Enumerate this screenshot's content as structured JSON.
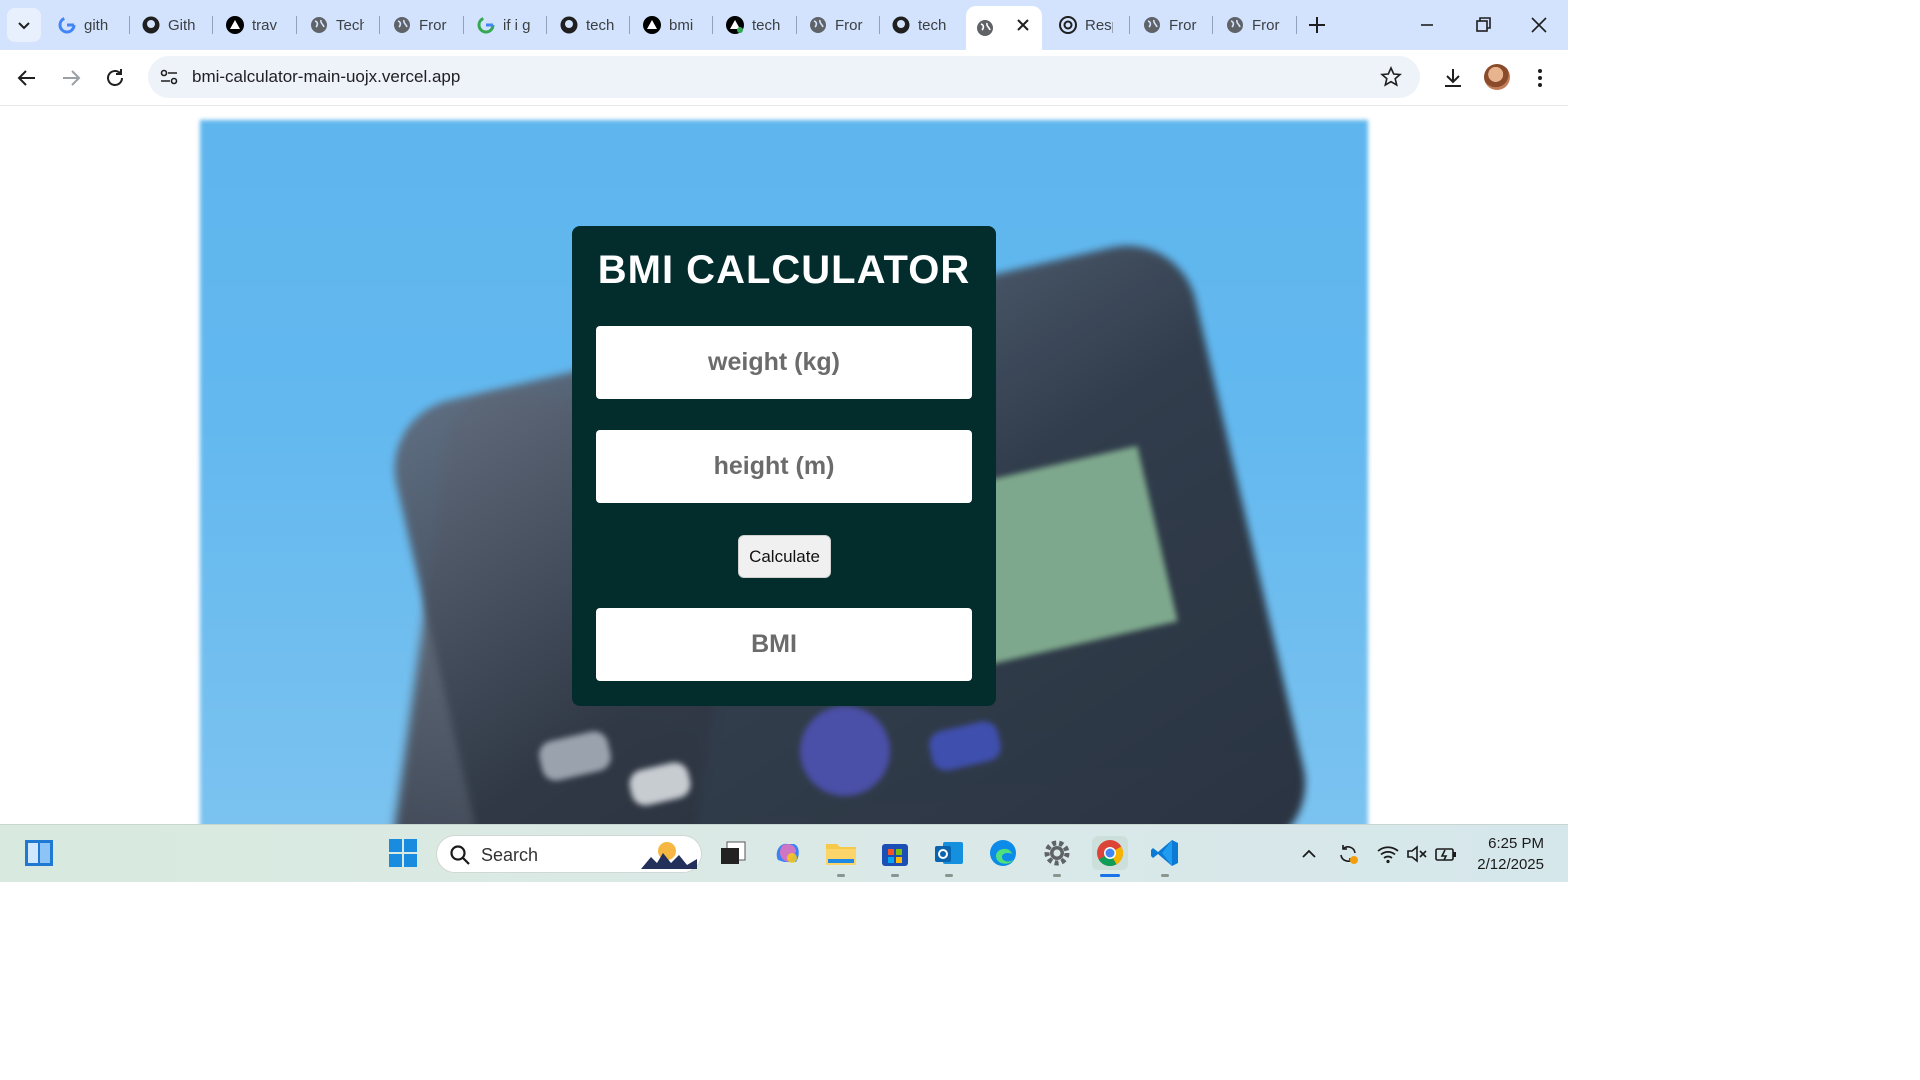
{
  "browser": {
    "tabs": [
      {
        "label": "gith",
        "icon": "google-icon"
      },
      {
        "label": "Gith",
        "icon": "github-icon"
      },
      {
        "label": "trav",
        "icon": "vercel-icon"
      },
      {
        "label": "Tech",
        "icon": "globe-icon"
      },
      {
        "label": "Fror",
        "icon": "globe-icon"
      },
      {
        "label": "if i g",
        "icon": "google-icon"
      },
      {
        "label": "tech",
        "icon": "github-icon"
      },
      {
        "label": "bmi",
        "icon": "vercel-icon"
      },
      {
        "label": "tech",
        "icon": "vercel-icon"
      },
      {
        "label": "Fror",
        "icon": "globe-icon"
      },
      {
        "label": "tech",
        "icon": "github-icon"
      },
      {
        "label": "",
        "icon": "globe-icon",
        "active": true
      },
      {
        "label": "Resp",
        "icon": "openai-icon"
      },
      {
        "label": "Fror",
        "icon": "globe-icon"
      },
      {
        "label": "Fror",
        "icon": "globe-icon"
      }
    ],
    "url": "bmi-calculator-main-uojx.vercel.app"
  },
  "app": {
    "title": "BMI CALCULATOR",
    "weight_placeholder": "weight (kg)",
    "height_placeholder": "height (m)",
    "calculate_label": "Calculate",
    "result_placeholder": "BMI",
    "card_color": "#032c2c"
  },
  "taskbar": {
    "search_label": "Search",
    "time": "6:25 PM",
    "date": "2/12/2025"
  }
}
